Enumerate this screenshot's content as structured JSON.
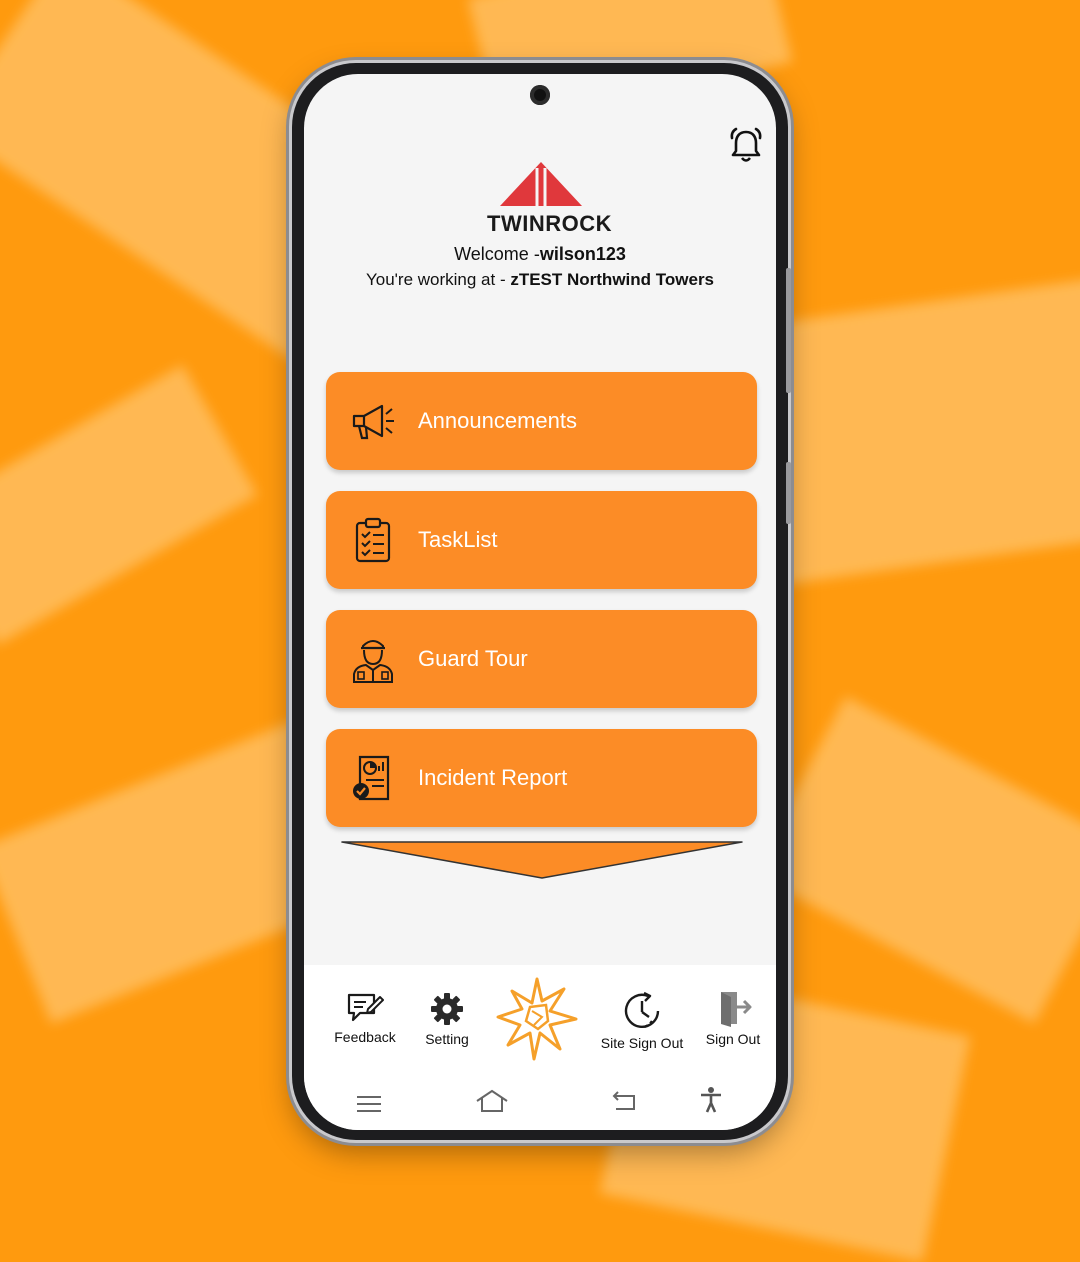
{
  "header": {
    "brand": "TWINROCK",
    "welcome_prefix": "Welcome -",
    "username": "wilson123",
    "working_prefix": "You're working at - ",
    "site": "zTEST Northwind Towers"
  },
  "menu": [
    {
      "label": "Announcements",
      "icon": "megaphone-icon"
    },
    {
      "label": "TaskList",
      "icon": "clipboard-icon"
    },
    {
      "label": "Guard Tour",
      "icon": "guard-icon"
    },
    {
      "label": "Incident Report",
      "icon": "report-icon"
    }
  ],
  "bottom_nav": {
    "feedback": "Feedback",
    "setting": "Setting",
    "site_sign_out": "Site Sign Out",
    "sign_out": "Sign Out"
  },
  "colors": {
    "accent": "#fc8c26",
    "background": "#ff9a0e",
    "logo_red": "#e0383c"
  },
  "icons": [
    "bell-icon",
    "megaphone-icon",
    "clipboard-icon",
    "guard-icon",
    "report-icon",
    "feedback-icon",
    "gear-icon",
    "lightning-logo-icon",
    "clock-icon",
    "sign-out-icon",
    "menu-icon",
    "home-icon",
    "back-icon",
    "accessibility-icon"
  ]
}
